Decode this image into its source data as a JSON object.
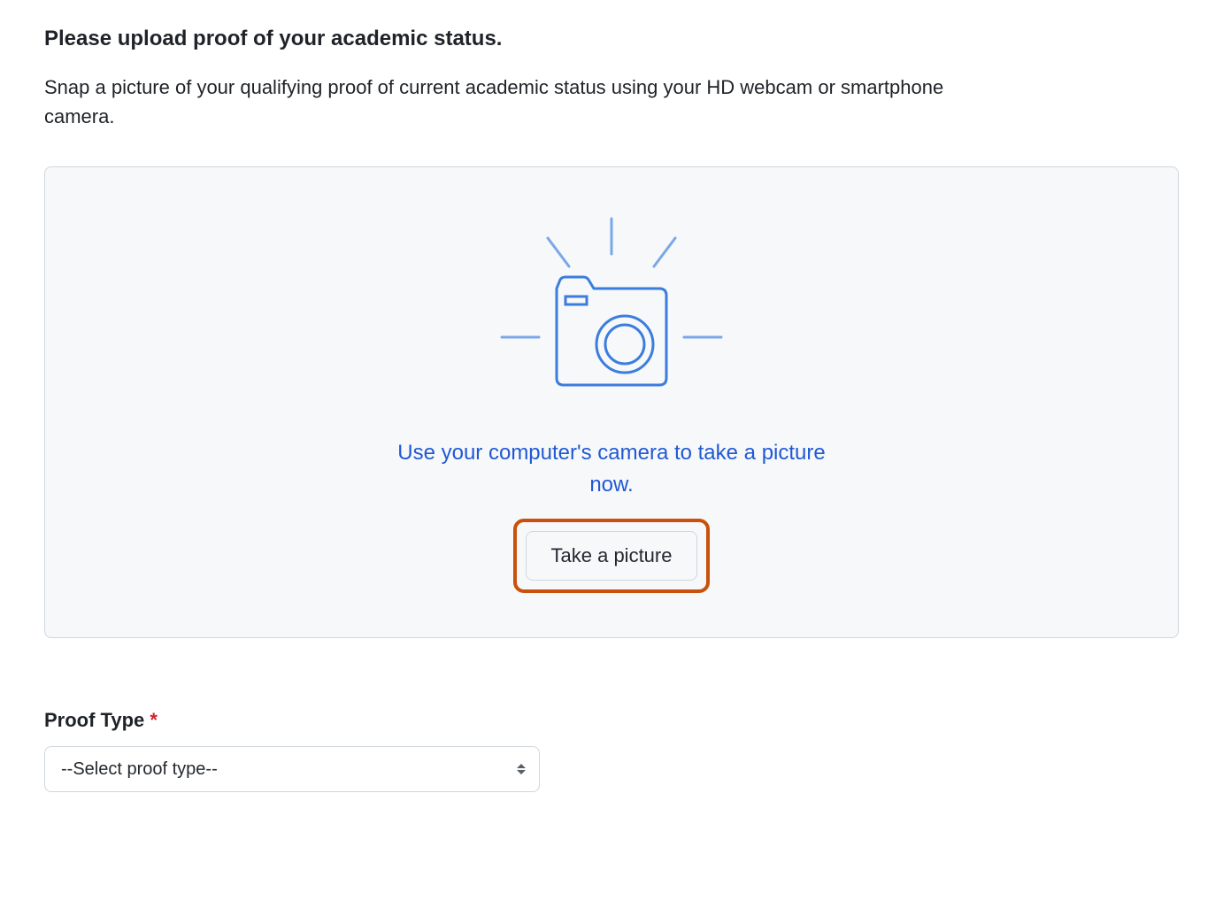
{
  "upload": {
    "heading": "Please upload proof of your academic status.",
    "description": "Snap a picture of your qualifying proof of current academic status using your HD webcam or smartphone camera.",
    "camera_instruction": "Use your computer's camera to take a picture now.",
    "take_picture_label": "Take a picture"
  },
  "proof_type": {
    "label": "Proof Type",
    "required_marker": "*",
    "placeholder_option": "--Select proof type--"
  },
  "colors": {
    "accent_blue": "#2159d3",
    "highlight_orange": "#c9510c",
    "box_bg": "#f6f8fa",
    "border": "#d0d7de",
    "required": "#cf222e"
  }
}
